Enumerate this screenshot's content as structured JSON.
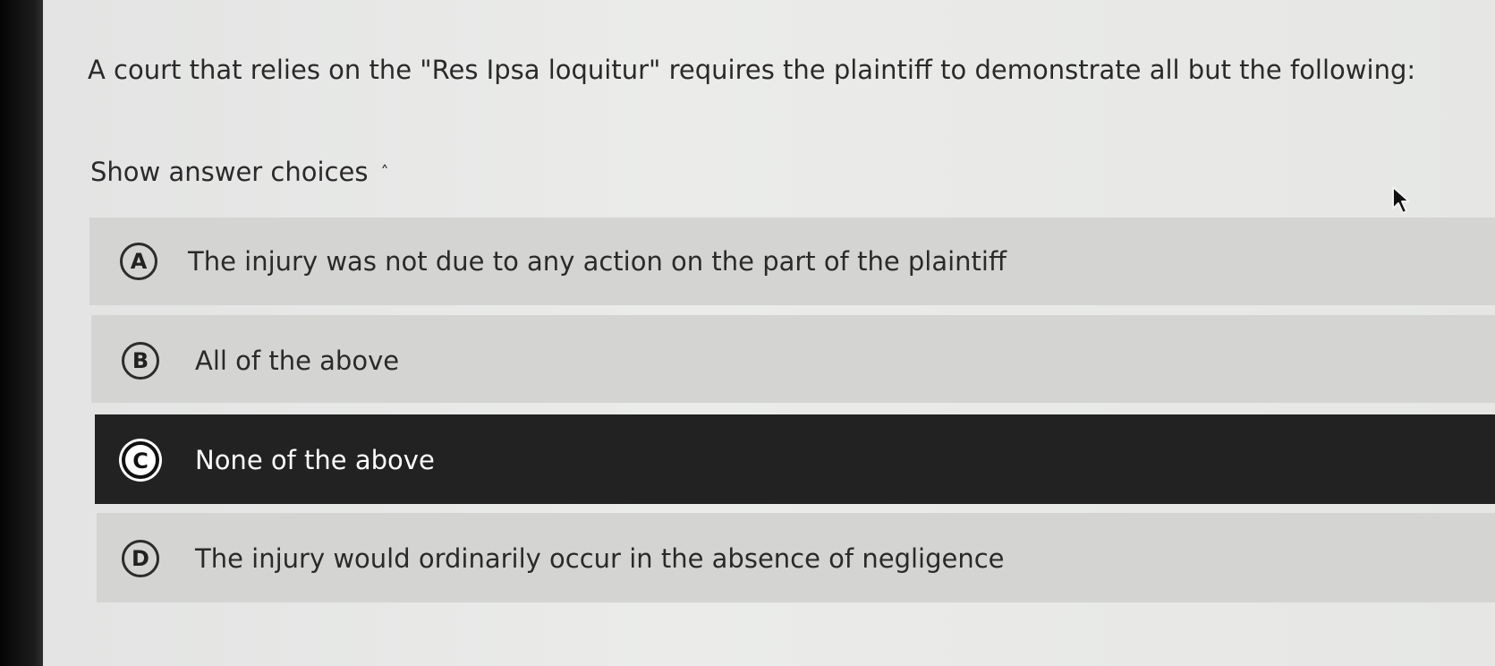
{
  "question": {
    "text": "A court that relies on the \"Res Ipsa loquitur\" requires the plaintiff to demonstrate all but the following:"
  },
  "answer_toggle": {
    "label": "Show answer choices",
    "icon": "chevron-up-icon",
    "expanded": true
  },
  "choices": [
    {
      "letter": "A",
      "text": "The injury was not due to any action on the part of the plaintiff",
      "selected": false
    },
    {
      "letter": "B",
      "text": "All of the above",
      "selected": false
    },
    {
      "letter": "C",
      "text": "None of the above",
      "selected": true
    },
    {
      "letter": "D",
      "text": "The injury would ordinarily occur in the absence of negligence",
      "selected": false
    }
  ],
  "colors": {
    "background": "#e6e7e5",
    "choice_background": "#d4d5d3",
    "selected_background": "#222222",
    "selected_text": "#ffffff",
    "text": "#2a2a2a"
  }
}
